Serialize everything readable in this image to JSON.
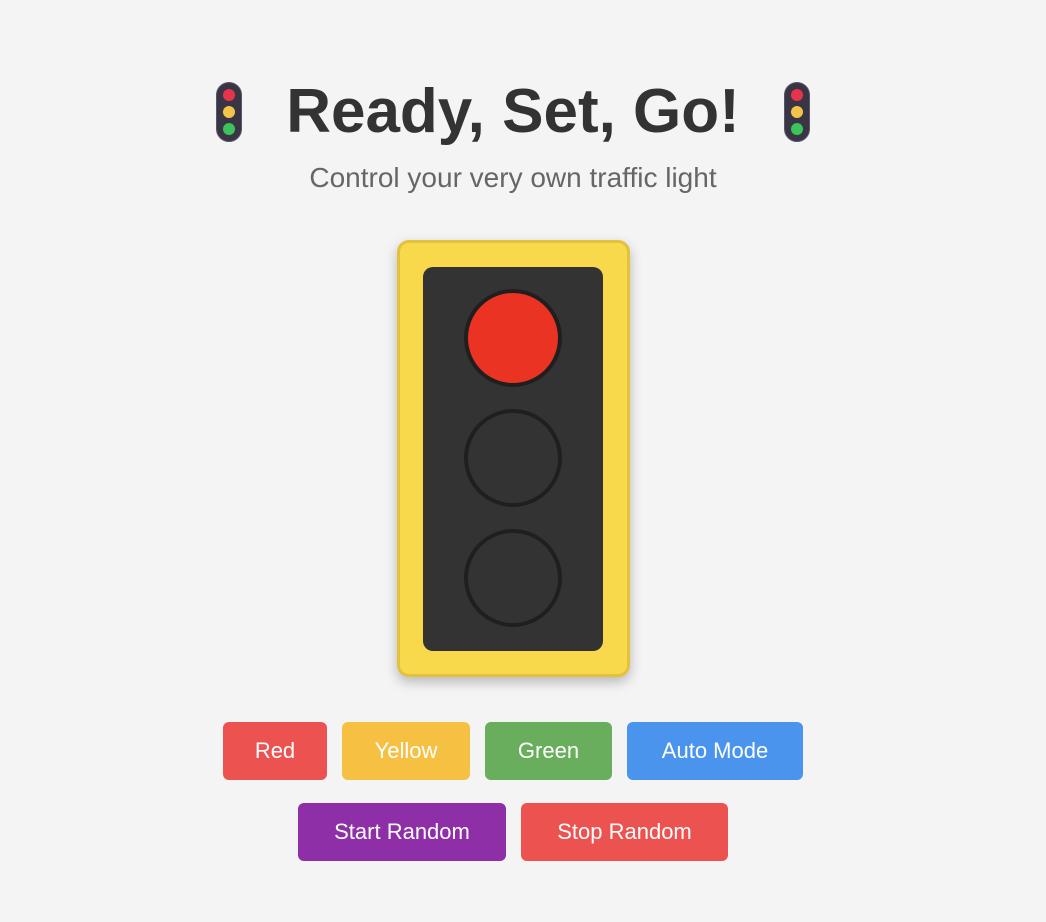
{
  "header": {
    "title": "Ready, Set, Go!",
    "subtitle": "Control your very own traffic light",
    "decor_icon": "traffic-light-icon"
  },
  "traffic_light": {
    "active": "red",
    "lamps": [
      {
        "name": "red",
        "on_color": "#ea3323"
      },
      {
        "name": "yellow",
        "on_color": "#f5c33c"
      },
      {
        "name": "green",
        "on_color": "#5cb85c"
      }
    ],
    "off_color": "#333333",
    "housing_color": "#f8d94c",
    "face_color": "#333333"
  },
  "controls": {
    "red_label": "Red",
    "yellow_label": "Yellow",
    "green_label": "Green",
    "auto_label": "Auto Mode",
    "start_random_label": "Start Random",
    "stop_random_label": "Stop Random"
  },
  "colors": {
    "red": "#ec5350",
    "yellow": "#f6c142",
    "green": "#68ae5c",
    "blue": "#4a94ee",
    "purple": "#8e2fa8",
    "background": "#f4f4f4"
  }
}
